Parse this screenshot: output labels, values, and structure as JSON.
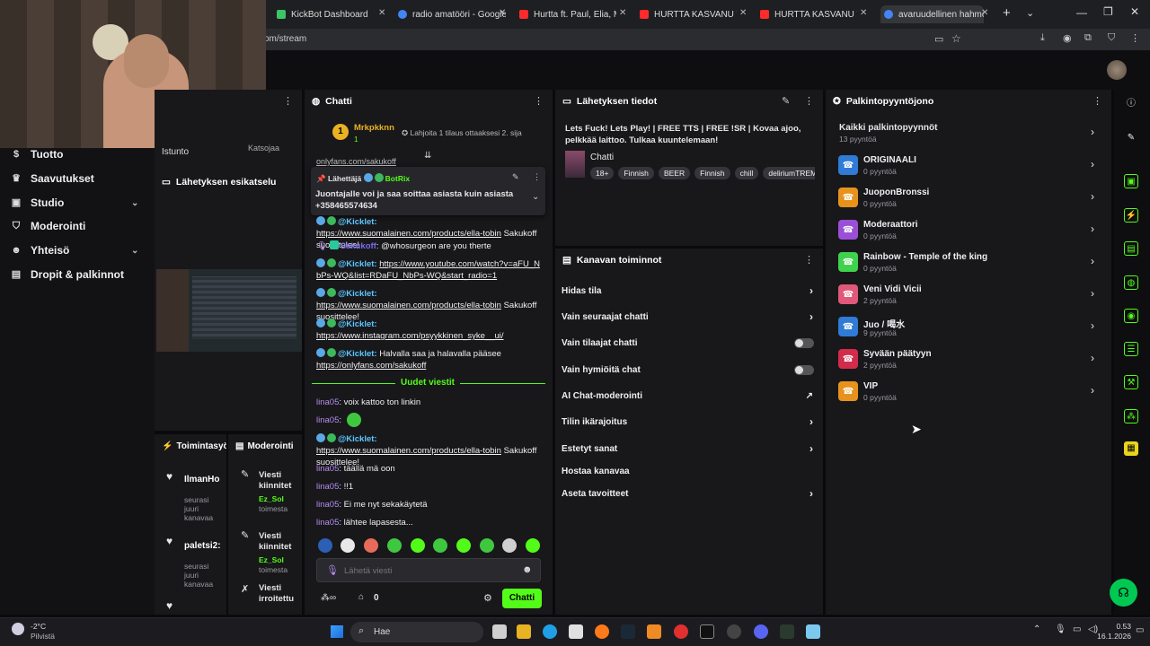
{
  "browser": {
    "tabs": [
      {
        "label": "KickBot Dashboard",
        "color": "#3cc466"
      },
      {
        "label": "radio amatööri - Google-h",
        "color": "#4285f4"
      },
      {
        "label": "Hurtta ft. Paul, Elia, Miki, R",
        "color": "#ff2a2a"
      },
      {
        "label": "HURTTA KASVANU VÄHÄN",
        "color": "#ff2a2a"
      },
      {
        "label": "HURTTA KASVANU VÄHÄN",
        "color": "#ff2a2a"
      },
      {
        "label": "avaruudellinen hahmotus -",
        "color": "#4285f4"
      }
    ],
    "url": "om/stream",
    "new_tab": "+"
  },
  "nav": {
    "items": [
      {
        "label": "Tuotto",
        "icon": "dollar-icon"
      },
      {
        "label": "Saavutukset",
        "icon": "trophy-icon"
      },
      {
        "label": "Studio",
        "icon": "studio-icon",
        "chev": "⌄"
      },
      {
        "label": "Moderointi",
        "icon": "shield-icon"
      },
      {
        "label": "Yhteisö",
        "icon": "people-icon",
        "chev": "⌄"
      },
      {
        "label": "Dropit & palkinnot",
        "icon": "gift-icon"
      }
    ],
    "istunto": "Istunto",
    "katsojaa": "Katsojaa"
  },
  "preview": {
    "title": "Lähetyksen esikatselu"
  },
  "activity": {
    "title": "Toimintasyöte",
    "items": [
      {
        "name": "IlmanHo",
        "meta": "seurasi juuri kanavaa"
      },
      {
        "name": "paletsi2:",
        "meta": "seurasi juuri kanavaa"
      }
    ]
  },
  "modlog": {
    "title": "Moderointi",
    "items": [
      {
        "title": "Viesti kiinnitet",
        "user": "Ez_Sol",
        "meta": "toimesta"
      },
      {
        "title": "Viesti kiinnitet",
        "user": "Ez_Sol",
        "meta": "toimesta"
      },
      {
        "title": "Viesti irroitettu",
        "user": "",
        "meta": ""
      }
    ]
  },
  "chat": {
    "title": "Chatti",
    "gift": {
      "user": "Mrkpkknn",
      "count": "1",
      "text": "Lahjoita 1 tilaus ottaaksesi 2. sija"
    },
    "truncated": "onlyfans.com/sakukoff",
    "pinned": {
      "label": "Lähettäjä",
      "bot": "BotRix",
      "text": "Juontajalle voi ja saa soittaa asiasta kuin asiasta +358465574634"
    },
    "messages": [
      {
        "user": "@Kicklet:",
        "link": "https://www.suomalainen.com/products/ella-tobin",
        "text": "Sakukoff suosittelee!"
      },
      {
        "user": "Sakukoff",
        "text": ": @whosurgeon are you therte"
      },
      {
        "user": "@Kicklet:",
        "link": "https://www.youtube.com/watch?v=aFU_NbPs-WQ&list=RDaFU_NbPs-WQ&start_radio=1",
        "text": ""
      },
      {
        "user": "@Kicklet:",
        "link": "https://www.suomalainen.com/products/ella-tobin",
        "text": "Sakukoff suosittelee!"
      },
      {
        "user": "@Kicklet:",
        "link": "https://www.instagram.com/psyykkinen_syke__ui/",
        "text": ""
      },
      {
        "user": "@Kicklet:",
        "pre": "Halvalla saa ja halavalla pääsee",
        "link": "https://onlyfans.com/sakukoff",
        "text": ""
      }
    ],
    "new_messages": "Uudet viestit",
    "new": [
      {
        "user": "lina05",
        "text": ": voix kattoo ton linkin"
      },
      {
        "user": "lina05",
        "text": ":"
      },
      {
        "user": "@Kicklet:",
        "link": "https://www.suomalainen.com/products/ella-tobin",
        "text": "Sakukoff suosittelee!"
      },
      {
        "user": "lina05",
        "text": ": täällä mä oon"
      },
      {
        "user": "lina05",
        "text": ": !!1"
      },
      {
        "user": "lina05",
        "text": ": Ei me nyt sekakäytetä"
      },
      {
        "user": "lina05",
        "text": ": lähtee lapasesta..."
      }
    ],
    "placeholder": "Lähetä viesti",
    "points": "0",
    "send": "Chatti"
  },
  "stream_info": {
    "title": "Lähetyksen tiedot",
    "stream_title": "Lets Fuck! Lets Play! | FREE TTS | FREE !SR | Kovaa ajoo, pelkkää laittoo. Tulkaa kuuntelemaan!",
    "category": "Chatti",
    "tags": [
      "18+",
      "Finnish",
      "BEER",
      "Finnish",
      "chill",
      "deliriumTREME"
    ]
  },
  "channel_actions": {
    "title": "Kanavan toiminnot",
    "items": [
      {
        "label": "Hidas tila",
        "kind": "arrow"
      },
      {
        "label": "Vain seuraajat chatti",
        "kind": "arrow"
      },
      {
        "label": "Vain tilaajat chatti",
        "kind": "toggle"
      },
      {
        "label": "Vain hymiöitä chat",
        "kind": "toggle"
      },
      {
        "label": "AI Chat-moderointi",
        "kind": "ext"
      },
      {
        "label": "Tilin ikärajoitus",
        "kind": "arrow"
      },
      {
        "label": "Estetyt sanat",
        "kind": "arrow"
      },
      {
        "label": "Hostaa kanavaa",
        "kind": "none"
      },
      {
        "label": "Aseta tavoitteet",
        "kind": "arrow"
      }
    ]
  },
  "rewards": {
    "title": "Palkintopyyntöjono",
    "all": "Kaikki palkintopyynnöt",
    "all_count": "13 pyyntöä",
    "items": [
      {
        "name": "ORIGINAALI",
        "count": "0 pyyntöä",
        "color": "#2f7bd6"
      },
      {
        "name": "JuoponBronssi",
        "count": "0 pyyntöä",
        "color": "#e8921e"
      },
      {
        "name": "Moderaattori",
        "count": "0 pyyntöä",
        "color": "#9b4fd6"
      },
      {
        "name": "Rainbow - Temple of the king",
        "count": "0 pyyntöä",
        "color": "#3fd24d"
      },
      {
        "name": "Veni Vidi Vicii",
        "count": "2 pyyntöä",
        "color": "#e0587a"
      },
      {
        "name": "Juo / 喝水",
        "count": "9 pyyntöä",
        "color": "#2f7bd6"
      },
      {
        "name": "Syvään päätyyn",
        "count": "2 pyyntöä",
        "color": "#d22b4c"
      },
      {
        "name": "VIP",
        "count": "0 pyyntöä",
        "color": "#e8921e"
      }
    ]
  },
  "taskbar": {
    "weather_temp": "-2°C",
    "weather_text": "Pilvistä",
    "search": "Hae",
    "time": "0.53",
    "date": "16.1.2026"
  }
}
